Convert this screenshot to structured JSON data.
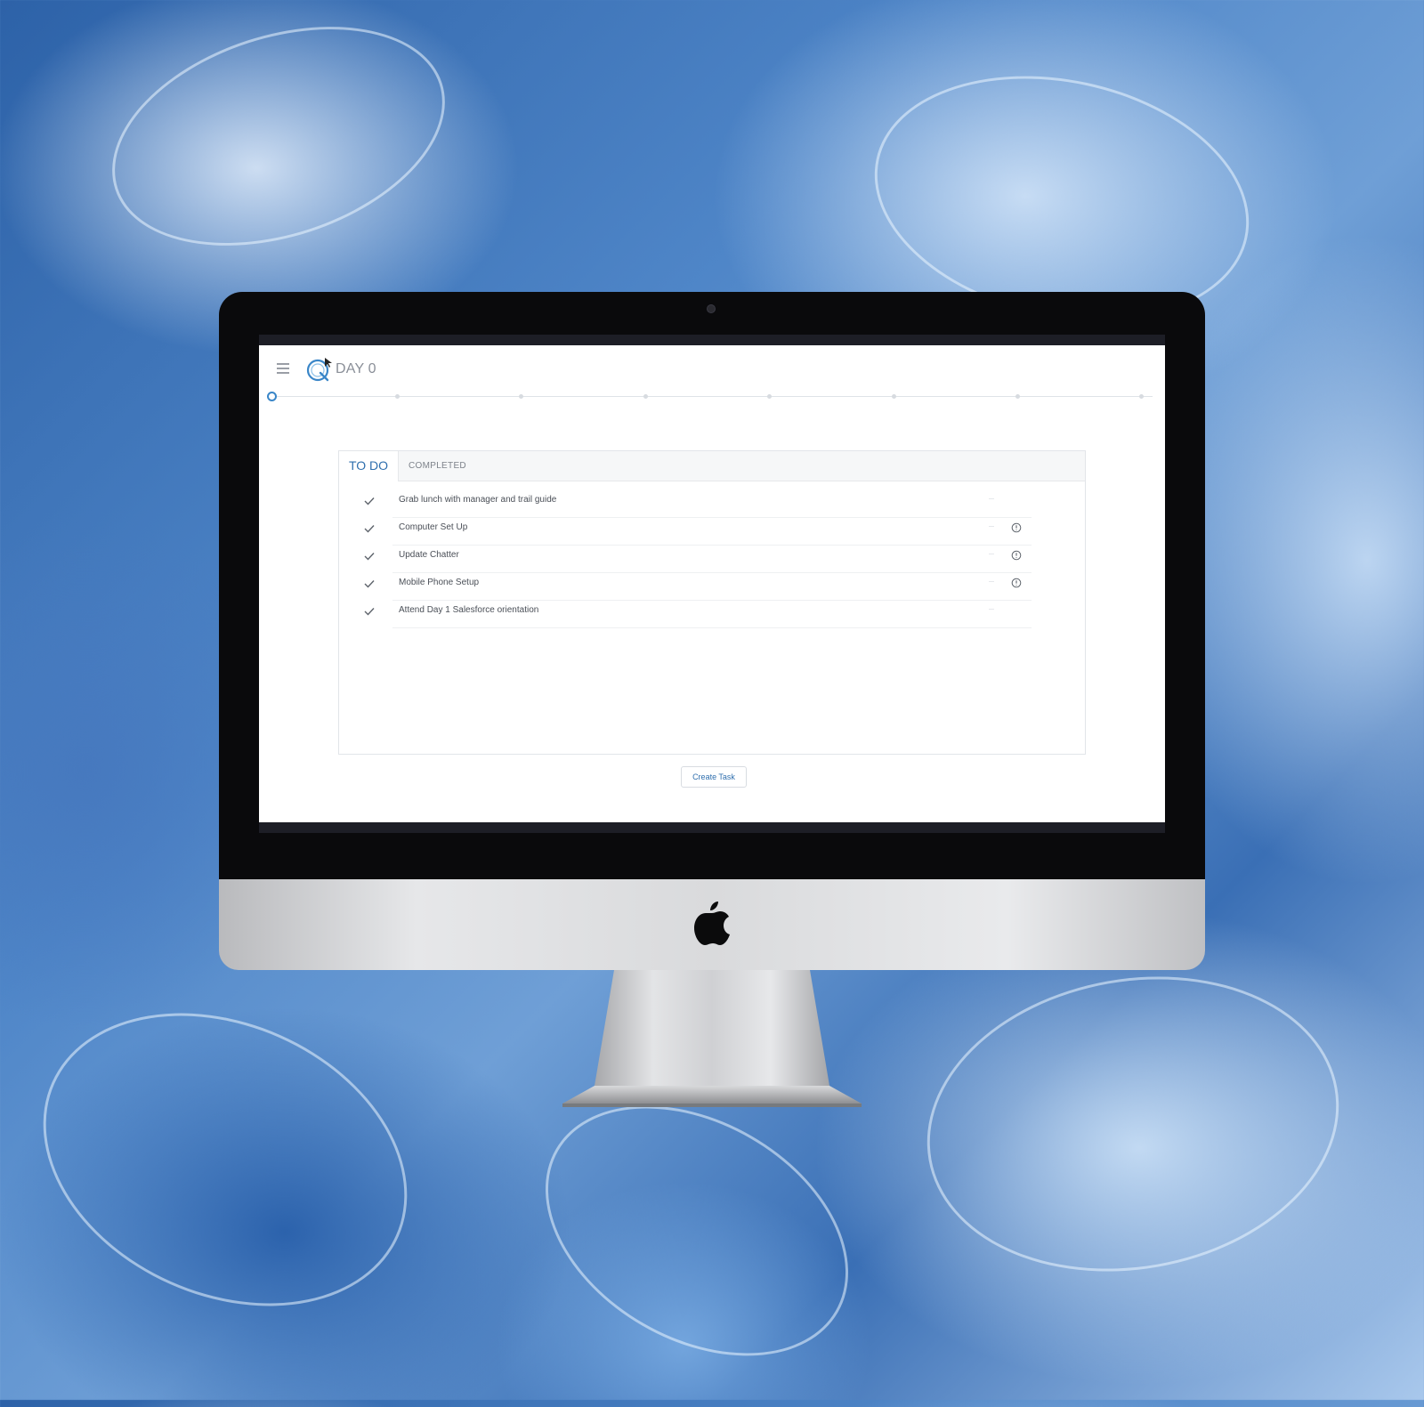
{
  "app": {
    "title": "DAY 0",
    "logo_icon": "q-logo-icon",
    "menu_icon": "hamburger-menu-icon",
    "accent_color": "#2f6fae"
  },
  "tabs": [
    {
      "label": "TO DO",
      "active": true
    },
    {
      "label": "COMPLETED",
      "active": false
    }
  ],
  "tasks": [
    {
      "label": "Grab lunch with manager and trail guide",
      "has_info": false
    },
    {
      "label": "Computer Set Up",
      "has_info": true
    },
    {
      "label": "Update Chatter",
      "has_info": true
    },
    {
      "label": "Mobile Phone Setup",
      "has_info": true
    },
    {
      "label": "Attend Day 1 Salesforce orientation",
      "has_info": false
    }
  ],
  "actions": {
    "create_task_label": "Create Task"
  },
  "device": {
    "brand_icon": "apple-logo-icon"
  }
}
